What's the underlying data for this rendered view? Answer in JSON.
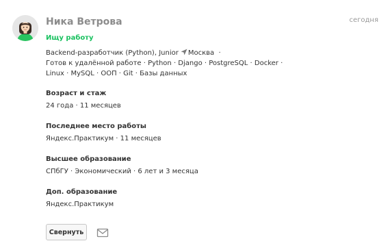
{
  "profile": {
    "avatar_icon": "woman-avatar-icon",
    "name": "Ника Ветрова",
    "date": "сегодня",
    "status": "Ищу работу",
    "status_color": "#19c15f"
  },
  "summary": {
    "position": "Backend-разработчик (Python), Junior",
    "location_icon": "location-arrow-icon",
    "city": "Москва",
    "sep": "·",
    "line2": "Готов к удалённой работе · Python · Django · PostgreSQL · Docker ·",
    "line3": "Linux · MySQL · ООП · Git · Базы данных"
  },
  "sections": {
    "age": {
      "title": "Возраст и стаж",
      "value": "24 года · 11 месяцев"
    },
    "last_job": {
      "title": "Последнее место работы",
      "value": "Яндекс.Практикум · 11 месяцев"
    },
    "education": {
      "title": "Высшее образование",
      "value": "СПбГУ · Экономический · 6 лет и 3 месяца"
    },
    "extra_education": {
      "title": "Доп. образование",
      "value": "Яндекс.Практикум"
    }
  },
  "actions": {
    "collapse_label": "Свернуть",
    "mail_icon": "envelope-icon"
  }
}
